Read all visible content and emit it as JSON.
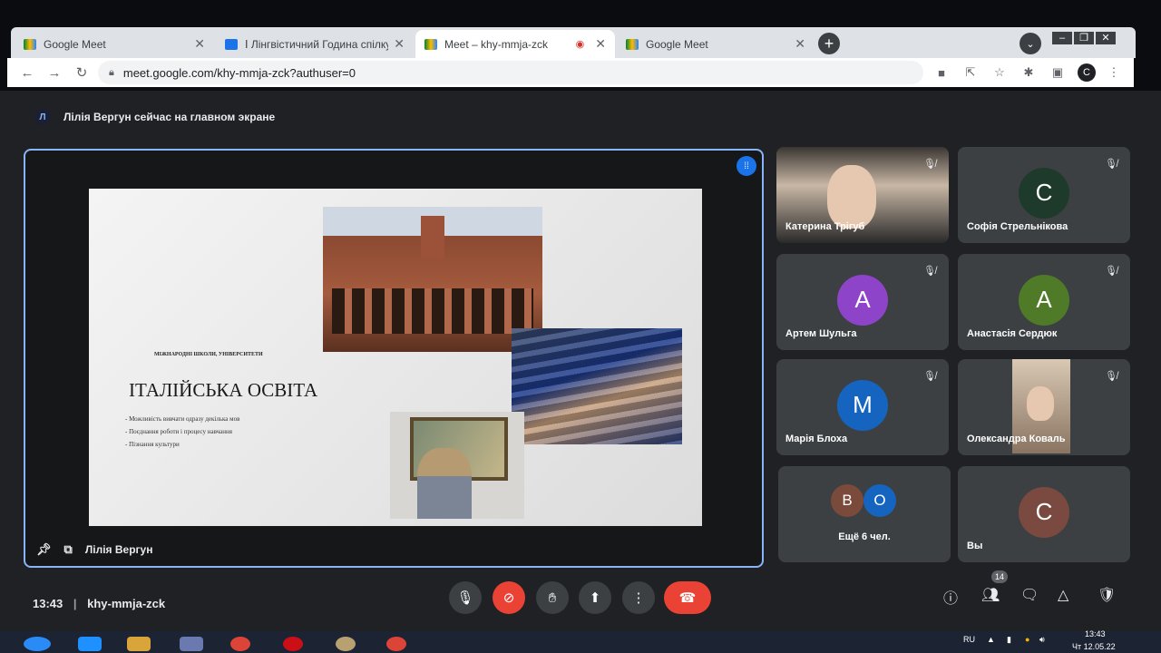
{
  "browser": {
    "tabs": [
      {
        "title": "Google Meet",
        "active": false
      },
      {
        "title": "Ⅰ Лінгвістичний Година спілкува",
        "active": false
      },
      {
        "title": "Meet – khy-mmja-zck",
        "active": true
      },
      {
        "title": "Google Meet",
        "active": false
      }
    ],
    "url": "meet.google.com/khy-mmja-zck?authuser=0",
    "profile_initial": "C",
    "new_tab_label": "+"
  },
  "meet": {
    "presenting_avatar": "Л",
    "presenting_text": "Лілія Вергун сейчас на главном экране",
    "presenter_name": "Лілія Вергун",
    "slide": {
      "subtitle": "МІЖНАРОДНІ ШКОЛИ, УНІВЕРСИТЕТИ",
      "title": "ІТАЛІЙСЬКА ОСВІТА",
      "bullets": [
        "- Можливість вивчати одразу декілька мов",
        "- Поєднання роботи і процесу навчання",
        "- Пізнання культури"
      ]
    },
    "participants": [
      {
        "name": "Катерина Трігуб",
        "initial": "",
        "color": ""
      },
      {
        "name": "Софія Стрельнікова",
        "initial": "С",
        "color": "#1e3a2a"
      },
      {
        "name": "Артем Шульга",
        "initial": "А",
        "color": "#8e44c8"
      },
      {
        "name": "Анастасія Сердюк",
        "initial": "А",
        "color": "#4f7a28"
      },
      {
        "name": "Марія Блоха",
        "initial": "М",
        "color": "#1565c0"
      },
      {
        "name": "Олександра Коваль",
        "initial": "",
        "color": ""
      }
    ],
    "more_tile": {
      "label": "Ещё 6 чел.",
      "initials": [
        "В",
        "О"
      ],
      "colors": [
        "#7a4a3a",
        "#1565c0"
      ]
    },
    "self_tile": {
      "label": "Вы",
      "initial": "С",
      "color": "#7a4a40"
    },
    "time": "13:43",
    "meeting_code": "khy-mmja-zck",
    "people_count": "14"
  },
  "taskbar": {
    "lang": "RU",
    "time": "13:43",
    "date": "Чт 12.05.22"
  }
}
